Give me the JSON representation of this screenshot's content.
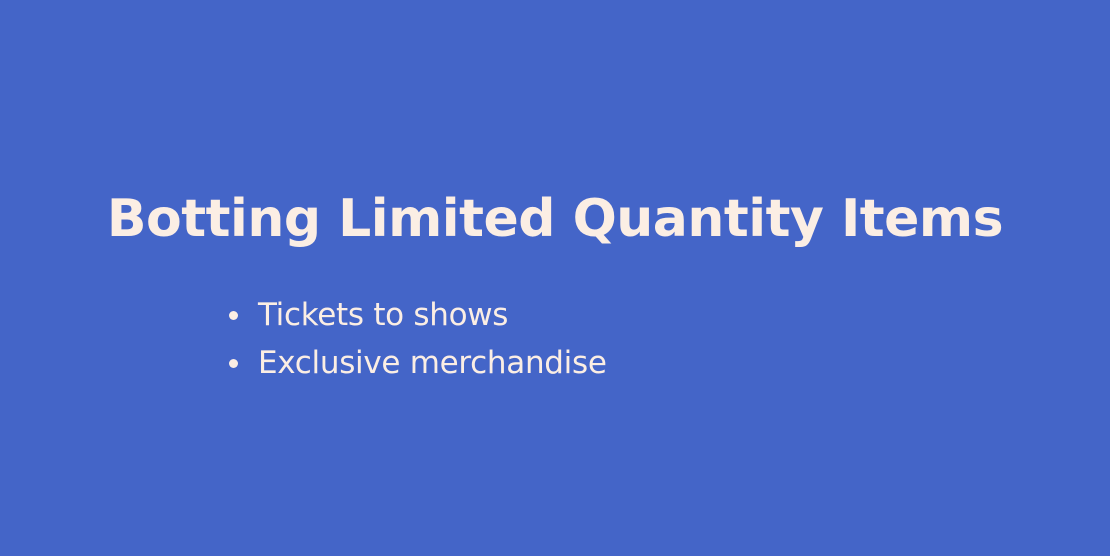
{
  "slide": {
    "title": "Botting Limited Quantity Items",
    "bullets": [
      "Tickets to shows",
      "Exclusive merchandise"
    ],
    "background_color": "#4465c8",
    "text_color": "#fbeee4"
  }
}
